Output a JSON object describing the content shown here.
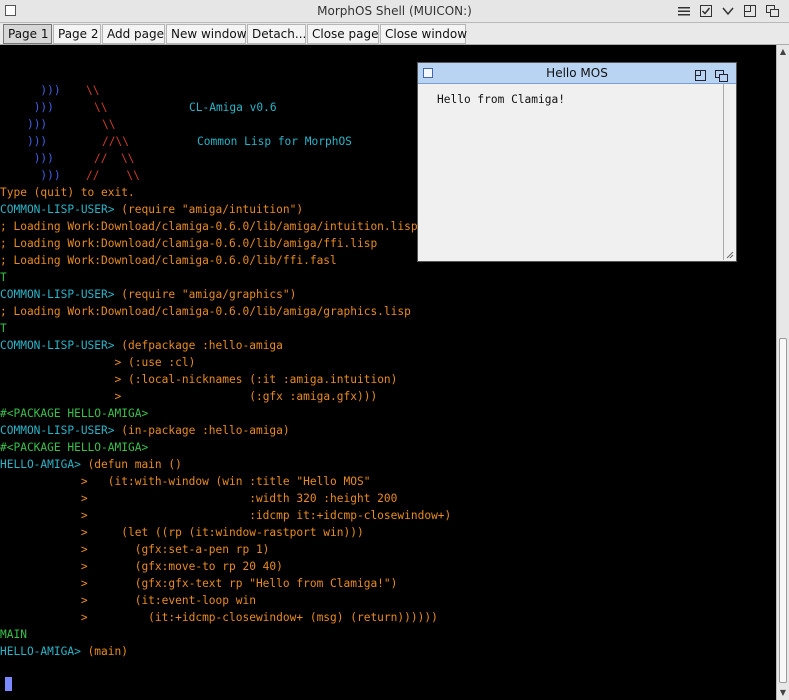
{
  "window": {
    "title": "MorphOS Shell (MUICON:)"
  },
  "tabs": [
    {
      "label": "Page 1",
      "active": true
    },
    {
      "label": "Page 2"
    },
    {
      "label": "Add page"
    },
    {
      "label": "New window"
    },
    {
      "label": "Detach..."
    },
    {
      "label": "Close page"
    },
    {
      "label": "Close window"
    }
  ],
  "terminal": {
    "colors": {
      "red": "#d23b2b",
      "blue": "#3e60e6",
      "cyan": "#2ab4c8",
      "orange": "#e88a20",
      "green": "#36c14a",
      "background": "#000000"
    },
    "banner": {
      "row1_blue": "  )))",
      "row1_red": "\\\\",
      "row2_blue": " )))",
      "row2_red": "\\\\",
      "row2_title": "CL-Amiga v0.6",
      "row3_blue": ")))",
      "row3_red": "\\\\",
      "row4_blue": ")))",
      "row4_red": "//\\\\",
      "row4_subtitle": "Common Lisp for MorphOS",
      "row5_blue": " )))",
      "row5_red": "//  \\\\",
      "row6_blue": "  )))",
      "row6_red": "//    \\\\"
    },
    "lines": [
      {
        "text": "Type (quit) to exit.",
        "color": "orange"
      },
      {
        "text": "COMMON-LISP-USER>",
        "color": "cyan",
        "rest": " (require \"amiga/intuition\")"
      },
      {
        "text": "; Loading Work:Download/clamiga-0.6.0/lib/amiga/intuition.lisp",
        "color": "orange"
      },
      {
        "text": "; Loading Work:Download/clamiga-0.6.0/lib/amiga/ffi.lisp",
        "color": "orange"
      },
      {
        "text": "; Loading Work:Download/clamiga-0.6.0/lib/ffi.fasl",
        "color": "orange"
      },
      {
        "text": "T",
        "color": "green"
      },
      {
        "text": "COMMON-LISP-USER>",
        "color": "cyan",
        "rest": " (require \"amiga/graphics\")"
      },
      {
        "text": "; Loading Work:Download/clamiga-0.6.0/lib/amiga/graphics.lisp",
        "color": "orange"
      },
      {
        "text": "T",
        "color": "green"
      },
      {
        "text": "COMMON-LISP-USER>",
        "color": "cyan",
        "rest": " (defpackage :hello-amiga"
      },
      {
        "text": "                 >",
        "color": "orange",
        "rest": " (:use :cl)"
      },
      {
        "text": "                 >",
        "color": "orange",
        "rest": " (:local-nicknames (:it :amiga.intuition)"
      },
      {
        "text": "                 >",
        "color": "orange",
        "rest": "                   (:gfx :amiga.gfx)))"
      },
      {
        "text": "#<PACKAGE HELLO-AMIGA>",
        "color": "green"
      },
      {
        "text": "COMMON-LISP-USER>",
        "color": "cyan",
        "rest": " (in-package :hello-amiga)"
      },
      {
        "text": "#<PACKAGE HELLO-AMIGA>",
        "color": "green"
      },
      {
        "text": "HELLO-AMIGA>",
        "color": "cyan",
        "rest": " (defun main ()"
      },
      {
        "text": "            >",
        "color": "orange",
        "rest": "   (it:with-window (win :title \"Hello MOS\""
      },
      {
        "text": "            >",
        "color": "orange",
        "rest": "                        :width 320 :height 200"
      },
      {
        "text": "            >",
        "color": "orange",
        "rest": "                        :idcmp it:+idcmp-closewindow+)"
      },
      {
        "text": "            >",
        "color": "orange",
        "rest": "     (let ((rp (it:window-rastport win)))"
      },
      {
        "text": "            >",
        "color": "orange",
        "rest": "       (gfx:set-a-pen rp 1)"
      },
      {
        "text": "            >",
        "color": "orange",
        "rest": "       (gfx:move-to rp 20 40)"
      },
      {
        "text": "            >",
        "color": "orange",
        "rest": "       (gfx:gfx-text rp \"Hello from Clamiga!\")"
      },
      {
        "text": "            >",
        "color": "orange",
        "rest": "       (it:event-loop win"
      },
      {
        "text": "            >",
        "color": "orange",
        "rest": "         (it:+idcmp-closewindow+ (msg) (return))))))"
      },
      {
        "text": "MAIN",
        "color": "green"
      },
      {
        "text": "HELLO-AMIGA>",
        "color": "cyan",
        "rest": " (main)"
      }
    ]
  },
  "hello_window": {
    "title": "Hello MOS",
    "text": "Hello from Clamiga!"
  }
}
